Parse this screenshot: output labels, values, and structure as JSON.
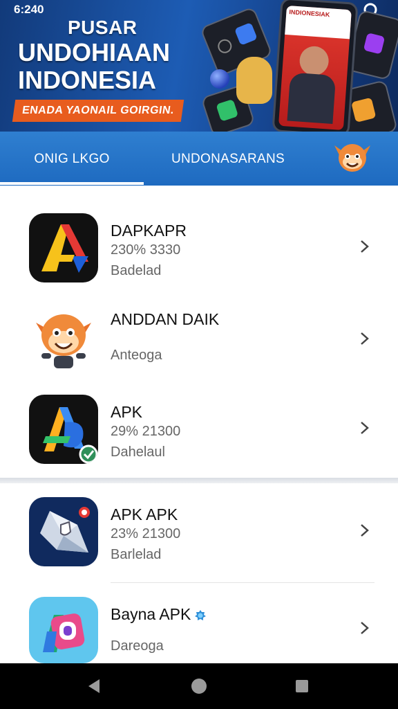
{
  "status_bar": {
    "time": "6:240"
  },
  "hero": {
    "title_line1": "PUSAR",
    "title_line2": "UNDOHIAAN",
    "title_line3": "INDONESIA",
    "ribbon": "ENADA YAONAIL GOIRGIN.",
    "phone_header": "INDIONESIAK"
  },
  "tabs": [
    {
      "label": "ONIG LKGO",
      "active": true
    },
    {
      "label": "UNDONASARANS",
      "active": false
    }
  ],
  "apps": [
    {
      "name": "DAPKAPR",
      "stats": "230% 3330",
      "sub": "Badelad",
      "icon": "red-yellow-a-logo-icon"
    },
    {
      "name": "ANDDAN DAIK",
      "stats": "",
      "sub": "Anteoga",
      "icon": "orange-mascot-icon"
    },
    {
      "name": "APK",
      "stats": "29% 21300",
      "sub": "Dahelaul",
      "icon": "blue-a-logo-icon"
    },
    {
      "name": "APK APK",
      "stats": "23% 21300",
      "sub": "Barlelad",
      "icon": "shield-star-icon"
    },
    {
      "name": "Bayna APK",
      "stats": "",
      "sub": "Dareoga",
      "icon": "colorful-camera-icon",
      "verified": true
    }
  ],
  "colors": {
    "tab_bar": "#2f7fd0",
    "hero_dark": "#123a7a",
    "ribbon": "#e85c1e",
    "text_primary": "#111111",
    "text_secondary": "#666666"
  },
  "nav": {
    "back": "back-icon",
    "home": "home-icon",
    "recent": "recent-apps-icon"
  }
}
